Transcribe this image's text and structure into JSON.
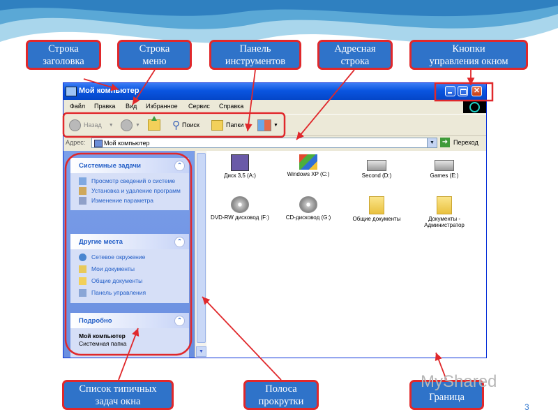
{
  "callouts": {
    "title_bar": [
      "Строка",
      "заголовка"
    ],
    "menu": [
      "Строка",
      "меню"
    ],
    "toolbar": [
      "Панель",
      "инструментов"
    ],
    "address_bar": [
      "Адресная",
      "строка"
    ],
    "window_controls": [
      "Кнопки",
      "управления окном"
    ],
    "task_list": [
      "Список типичных",
      "задач окна"
    ],
    "scrollbar": [
      "Полоса",
      "прокрутки"
    ],
    "border": [
      "Граница"
    ]
  },
  "window": {
    "title": "Мой компьютер",
    "menu": [
      "Файл",
      "Правка",
      "Вид",
      "Избранное",
      "Сервис",
      "Справка"
    ],
    "toolbar": {
      "back": "Назад",
      "search": "Поиск",
      "folders": "Папки"
    },
    "address": {
      "label": "Адрес:",
      "value": "Мой компьютер",
      "go": "Переход"
    },
    "tasks": {
      "system": {
        "title": "Системные задачи",
        "items": [
          "Просмотр сведений о системе",
          "Установка и удаление программ",
          "Изменение параметра"
        ]
      },
      "other": {
        "title": "Другие места",
        "items": [
          "Сетевое окружение",
          "Мои документы",
          "Общие документы",
          "Панель управления"
        ]
      },
      "details": {
        "title": "Подробно",
        "name": "Мой компьютер",
        "desc": "Системная папка"
      }
    },
    "drives": [
      {
        "label": "Диск 3,5 (A:)",
        "icon": "floppy-icon"
      },
      {
        "label": "Windows XP (C:)",
        "icon": "system-drive-icon"
      },
      {
        "label": "Second (D:)",
        "icon": "hard-drive-icon"
      },
      {
        "label": "Games (E:)",
        "icon": "hard-drive-icon"
      },
      {
        "label": "DVD-RW дисковод (F:)",
        "icon": "dvd-drive-icon"
      },
      {
        "label": "CD-дисковод (G:)",
        "icon": "cd-drive-icon"
      },
      {
        "label": "Общие документы",
        "icon": "folder-icon"
      },
      {
        "label": "Документы - Администратор",
        "icon": "folder-icon"
      }
    ]
  },
  "watermark": "MyShared",
  "page_number": "3",
  "colors": {
    "callout_bg": "#2f73c9",
    "callout_border": "#e0282b",
    "arrow": "#e0282b",
    "titlebar": "#0a55e0"
  }
}
